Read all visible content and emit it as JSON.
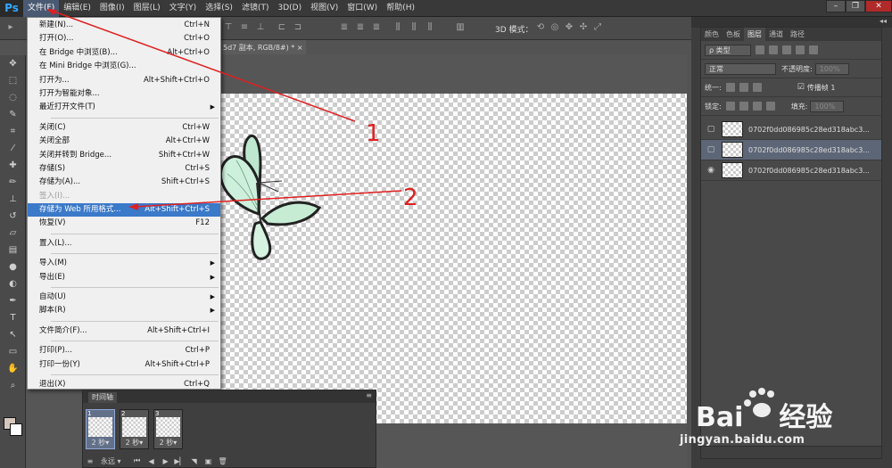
{
  "app": {
    "logo": "Ps",
    "menu": [
      "文件(F)",
      "编辑(E)",
      "图像(I)",
      "图层(L)",
      "文字(Y)",
      "选择(S)",
      "滤镜(T)",
      "3D(D)",
      "视图(V)",
      "窗口(W)",
      "帮助(H)"
    ],
    "active_menu": "文件(F)"
  },
  "options_bar": {
    "mode_3d_label": "3D 模式："
  },
  "document_tab": {
    "title": "5d7 副本, RGB/8#) *",
    "close": "×"
  },
  "file_menu": {
    "items": [
      {
        "label": "新建(N)...",
        "shortcut": "Ctrl+N"
      },
      {
        "label": "打开(O)...",
        "shortcut": "Ctrl+O"
      },
      {
        "label": "在 Bridge 中浏览(B)...",
        "shortcut": "Alt+Ctrl+O"
      },
      {
        "label": "在 Mini Bridge 中浏览(G)...",
        "shortcut": ""
      },
      {
        "label": "打开为...",
        "shortcut": "Alt+Shift+Ctrl+O"
      },
      {
        "label": "打开为智能对象...",
        "shortcut": ""
      },
      {
        "label": "最近打开文件(T)",
        "shortcut": "",
        "submenu": true
      },
      {
        "sep": true
      },
      {
        "label": "关闭(C)",
        "shortcut": "Ctrl+W"
      },
      {
        "label": "关闭全部",
        "shortcut": "Alt+Ctrl+W"
      },
      {
        "label": "关闭并转到 Bridge...",
        "shortcut": "Shift+Ctrl+W"
      },
      {
        "label": "存储(S)",
        "shortcut": "Ctrl+S"
      },
      {
        "label": "存储为(A)...",
        "shortcut": "Shift+Ctrl+S"
      },
      {
        "label": "签入(I)...",
        "shortcut": "",
        "disabled": true
      },
      {
        "label": "存储为 Web 所用格式...",
        "shortcut": "Alt+Shift+Ctrl+S",
        "highlight": true
      },
      {
        "label": "恢复(V)",
        "shortcut": "F12"
      },
      {
        "sep": true
      },
      {
        "label": "置入(L)...",
        "shortcut": ""
      },
      {
        "sep": true
      },
      {
        "label": "导入(M)",
        "shortcut": "",
        "submenu": true
      },
      {
        "label": "导出(E)",
        "shortcut": "",
        "submenu": true
      },
      {
        "sep": true
      },
      {
        "label": "自动(U)",
        "shortcut": "",
        "submenu": true
      },
      {
        "label": "脚本(R)",
        "shortcut": "",
        "submenu": true
      },
      {
        "sep": true
      },
      {
        "label": "文件简介(F)...",
        "shortcut": "Alt+Shift+Ctrl+I"
      },
      {
        "sep": true
      },
      {
        "label": "打印(P)...",
        "shortcut": "Ctrl+P"
      },
      {
        "label": "打印一份(Y)",
        "shortcut": "Alt+Shift+Ctrl+P"
      },
      {
        "sep": true
      },
      {
        "label": "退出(X)",
        "shortcut": "Ctrl+Q"
      }
    ]
  },
  "layers_panel": {
    "tabs": [
      "颜色",
      "色板",
      "图层",
      "通道",
      "路径"
    ],
    "active_tab": "图层",
    "filter_kind": "ρ 类型",
    "blend_mode": "正常",
    "opacity_label": "不透明度:",
    "opacity_value": "100%",
    "unify_label": "统一:",
    "propagate_label": "传播帧 1",
    "lock_label": "锁定:",
    "fill_label": "填充:",
    "fill_value": "100%",
    "layers": [
      {
        "name": "0702f0dd086985c28ed318abc3...",
        "visible": false,
        "selected": false
      },
      {
        "name": "0702f0dd086985c28ed318abc3...",
        "visible": false,
        "selected": true
      },
      {
        "name": "0702f0dd086985c28ed318abc3...",
        "visible": true,
        "selected": false
      }
    ],
    "collapse": "◂◂"
  },
  "timeline": {
    "title": "时间轴",
    "frames": [
      {
        "num": "1",
        "delay": "2 秒▾",
        "selected": true
      },
      {
        "num": "2",
        "delay": "2 秒▾",
        "selected": false
      },
      {
        "num": "3",
        "delay": "2 秒▾",
        "selected": false
      }
    ],
    "loop": "永远 ▾"
  },
  "annotations": {
    "label1": "1",
    "label2": "2",
    "color": "#e02020"
  },
  "watermark": {
    "brand": "Bai",
    "brand2": "经验",
    "url": "jingyan.baidu.com"
  },
  "colors": {
    "menu_highlight": "#3b79c9",
    "ps_blue": "#31a8ff"
  }
}
